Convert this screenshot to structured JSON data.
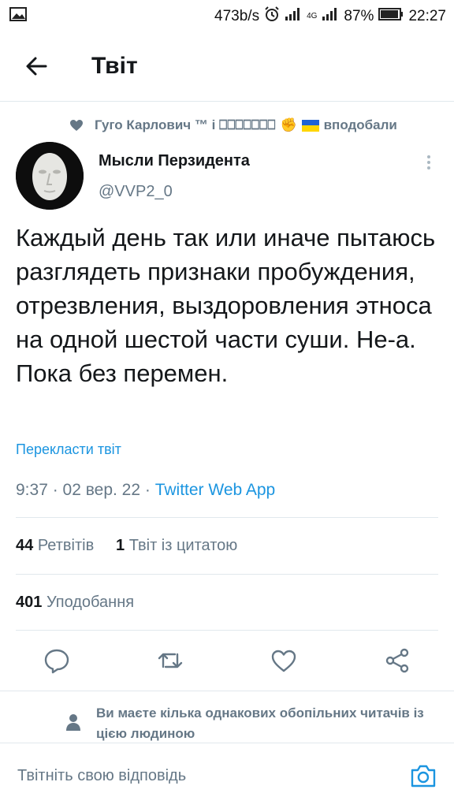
{
  "status_bar": {
    "speed": "473b/s",
    "network": "4G",
    "battery": "87%",
    "time": "22:27",
    "icons": [
      "image-icon",
      "alarm-icon",
      "signal-icon",
      "battery-icon"
    ]
  },
  "header": {
    "title": "Твіт",
    "back_icon": "arrow-left-icon"
  },
  "liked_by": {
    "names": "Гуго Карлович ™ і ⎕⎕⎕⎕⎕⎕⎕",
    "fist": "✊",
    "suffix": "вподобали"
  },
  "author": {
    "name": "Мысли Перзидента",
    "handle": "@VVP2_0"
  },
  "tweet": {
    "text": "Каждый день так или иначе пытаюсь разглядеть признаки пробуждения, отрезвления, выздоровления этноса на одной шестой части суши. Не-а. Пока без перемен.",
    "translate": "Перекласти твіт",
    "time_date": "9:37 · 02 вер. 22 · ",
    "source": "Twitter Web App"
  },
  "stats": {
    "retweets_count": "44",
    "retweets_label": "Ретвітів",
    "quotes_count": "1",
    "quotes_label": "Твіт із цитатою",
    "likes_count": "401",
    "likes_label": "Уподобання"
  },
  "followers_note": "Ви маєте кілька однакових обопільних читачів із цією людиною",
  "reply": {
    "placeholder": "Твітніть свою відповідь"
  },
  "colors": {
    "accent": "#1b95e0",
    "secondary_text": "#657786",
    "divider": "#e1e8ed"
  }
}
